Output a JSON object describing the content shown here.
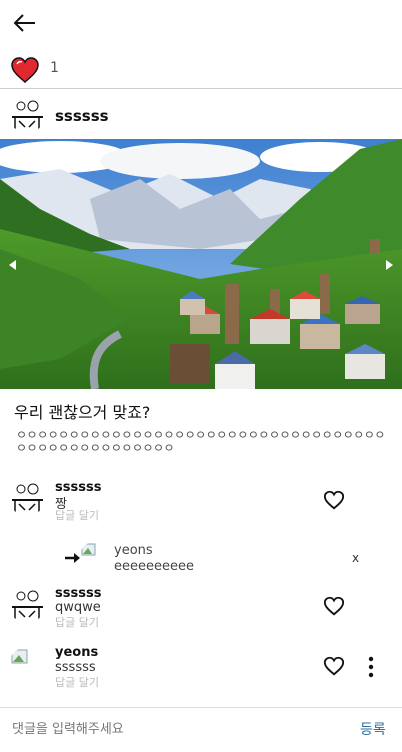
{
  "header": {
    "back_icon": "arrow-left-icon"
  },
  "likes": {
    "icon": "filled-heart-icon",
    "count": "1",
    "heart_color": "#e0282e"
  },
  "post": {
    "author": "ssssss",
    "caption": "우리 괜찮으거 맞죠?",
    "body": "ㅇㅇㅇㅇㅇㅇㅇㅇㅇㅇㅇㅇㅇㅇㅇㅇㅇㅇㅇㅇㅇㅇㅇㅇㅇㅇㅇㅇㅇㅇㅇㅇㅇㅇㅇㅇㅇㅇㅇㅇㅇㅇㅇㅇㅇㅇㅇㅇㅇㅇ"
  },
  "comments": [
    {
      "name": "ssssss",
      "text": "짱",
      "reply_label": "답글 달기"
    },
    {
      "name": "ssssss",
      "text": "qwqwe",
      "reply_label": "답글 달기"
    },
    {
      "name": "yeons",
      "text": "ssssss",
      "reply_label": "답글 달기"
    }
  ],
  "reply": {
    "name": "yeons",
    "text": "eeeeeeeeee",
    "delete_label": "x"
  },
  "comment_input": {
    "placeholder": "댓글을 입력해주세요",
    "submit_label": "등록",
    "accent": "#2c6f9e"
  }
}
